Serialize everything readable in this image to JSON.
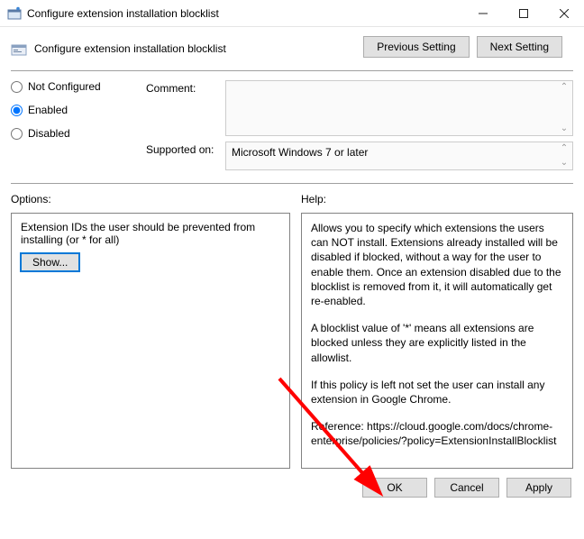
{
  "window": {
    "title": "Configure extension installation blocklist"
  },
  "header": {
    "subtitle": "Configure extension installation blocklist",
    "prev": "Previous Setting",
    "next": "Next Setting"
  },
  "state": {
    "not_configured": "Not Configured",
    "enabled": "Enabled",
    "disabled": "Disabled",
    "selected": "enabled"
  },
  "fields": {
    "comment_label": "Comment:",
    "comment_value": "",
    "supported_label": "Supported on:",
    "supported_value": "Microsoft Windows 7 or later"
  },
  "options": {
    "heading": "Options:",
    "desc": "Extension IDs the user should be prevented from installing (or * for all)",
    "show": "Show..."
  },
  "help": {
    "heading": "Help:",
    "p1": "Allows you to specify which extensions the users can NOT install. Extensions already installed will be disabled if blocked, without a way for the user to enable them. Once an extension disabled due to the blocklist is removed from it, it will automatically get re-enabled.",
    "p2": "A blocklist value of '*' means all extensions are blocked unless they are explicitly listed in the allowlist.",
    "p3": "If this policy is left not set the user can install any extension in Google Chrome.",
    "p4": "Reference: https://cloud.google.com/docs/chrome-enterprise/policies/?policy=ExtensionInstallBlocklist"
  },
  "footer": {
    "ok": "OK",
    "cancel": "Cancel",
    "apply": "Apply"
  }
}
